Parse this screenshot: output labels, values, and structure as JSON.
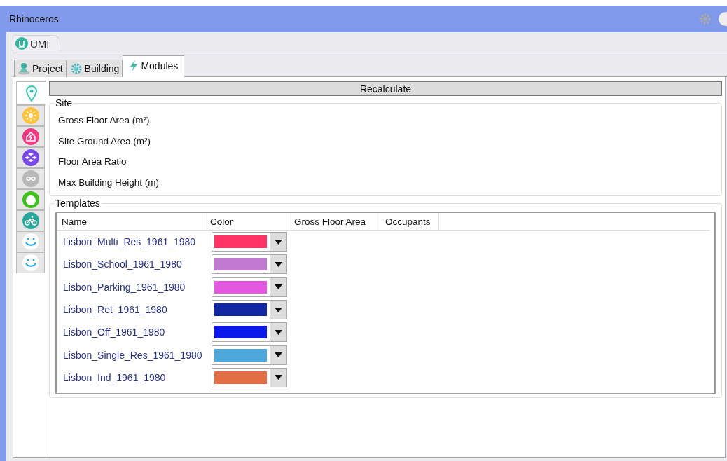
{
  "window": {
    "title": "Rhinoceros"
  },
  "doc_tabs": [
    {
      "label": "UMI",
      "selected": true
    }
  ],
  "tabs": [
    {
      "label": "Project",
      "kind": "person",
      "selected": false
    },
    {
      "label": "Building",
      "kind": "gear",
      "selected": false
    },
    {
      "label": "Modules",
      "kind": "bolt",
      "selected": true
    }
  ],
  "side_tabs": [
    {
      "kind": "pin",
      "selected": true
    },
    {
      "kind": "sun",
      "selected": false
    },
    {
      "kind": "energy",
      "selected": false
    },
    {
      "kind": "blocks",
      "selected": false
    },
    {
      "kind": "loop",
      "selected": false
    },
    {
      "kind": "food",
      "selected": false
    },
    {
      "kind": "bike",
      "selected": false
    },
    {
      "kind": "smiley",
      "selected": false
    },
    {
      "kind": "smiley",
      "selected": false
    }
  ],
  "recalculate_button": "Recalculate",
  "site": {
    "title": "Site",
    "fields": [
      "Gross Floor Area (m²)",
      "Site Ground Area (m²)",
      "Floor Area Ratio",
      "Max Building Height (m)"
    ]
  },
  "templates": {
    "title": "Templates",
    "columns": [
      "Name",
      "Color",
      "Gross Floor Area",
      "Occupants"
    ],
    "rows": [
      {
        "name": "Lisbon_Multi_Res_1961_1980",
        "color": "#ff3366"
      },
      {
        "name": "Lisbon_School_1961_1980",
        "color": "#c17ad0"
      },
      {
        "name": "Lisbon_Parking_1961_1980",
        "color": "#e457e0"
      },
      {
        "name": "Lisbon_Ret_1961_1980",
        "color": "#1228a3"
      },
      {
        "name": "Lisbon_Off_1961_1980",
        "color": "#0a18ea"
      },
      {
        "name": "Lisbon_Single_Res_1961_1980",
        "color": "#4fa8dc"
      },
      {
        "name": "Lisbon_Ind_1961_1980",
        "color": "#e36f47"
      }
    ]
  }
}
